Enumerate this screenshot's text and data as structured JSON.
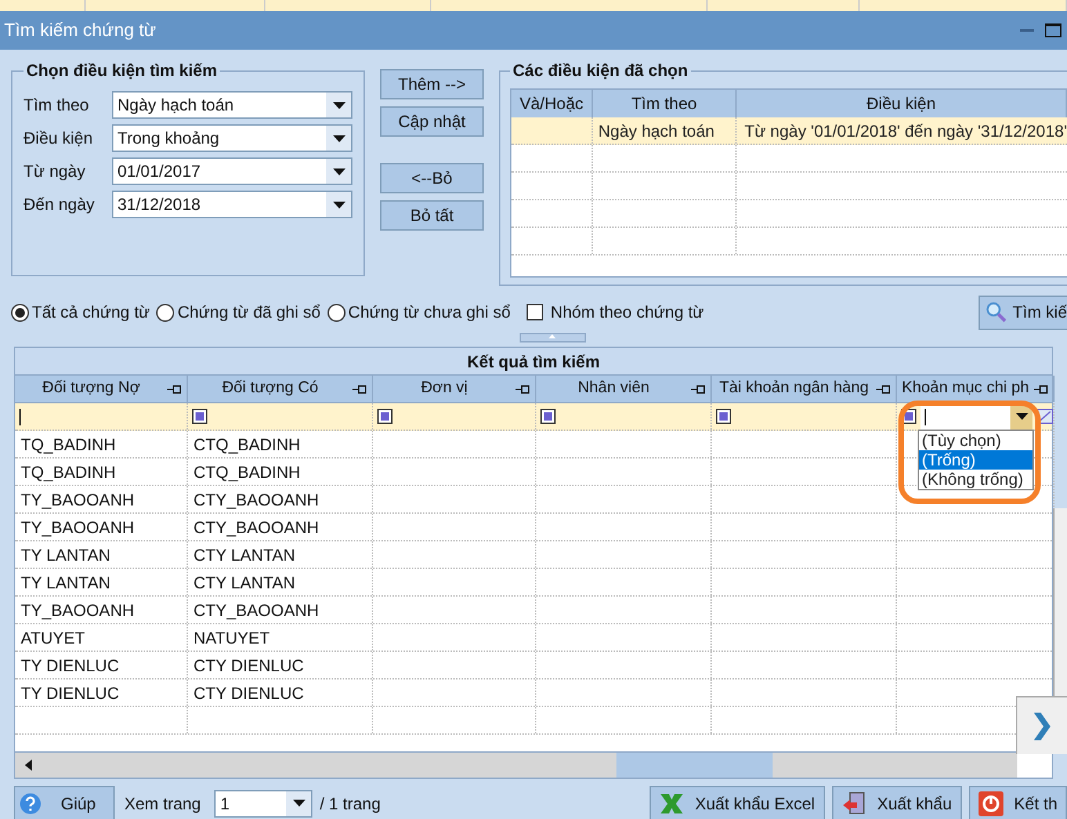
{
  "window": {
    "title": "Tìm kiếm chứng từ"
  },
  "criteria_group": {
    "title": "Chọn điều kiện tìm kiếm",
    "fields": [
      {
        "label": "Tìm theo",
        "value": "Ngày hạch toán"
      },
      {
        "label": "Điều kiện",
        "value": "Trong khoảng"
      },
      {
        "label": "Từ ngày",
        "value": "01/01/2017"
      },
      {
        "label": "Đến ngày",
        "value": "31/12/2018"
      }
    ]
  },
  "middle_buttons": [
    "Thêm -->",
    "Cập nhật",
    "<--Bỏ",
    "Bỏ tất"
  ],
  "selected_group": {
    "title": "Các điều kiện đã chọn",
    "columns": [
      "Và/Hoặc",
      "Tìm theo",
      "Điều kiện"
    ],
    "rows": [
      {
        "search_by": "Ngày hạch toán",
        "condition": "Từ ngày '01/01/2018' đến ngày '31/12/2018'",
        "selected": true
      }
    ]
  },
  "scope_options": [
    {
      "label": "Tất cả chứng từ",
      "selected": true
    },
    {
      "label": "Chứng từ đã ghi sổ",
      "selected": false
    },
    {
      "label": "Chứng từ chưa ghi sổ",
      "selected": false
    }
  ],
  "group_by_voucher": {
    "label": "Nhóm theo chứng từ",
    "checked": false
  },
  "search_button": "Tìm kiế",
  "results": {
    "title": "Kết quả tìm kiếm",
    "columns": [
      "Đối tượng Nợ",
      "Đối tượng Có",
      "Đơn vị",
      "Nhân viên",
      "Tài khoản ngân hàng",
      "Khoản mục chi ph"
    ],
    "rows": [
      [
        "TQ_BADINH",
        "CTQ_BADINH"
      ],
      [
        "TQ_BADINH",
        "CTQ_BADINH"
      ],
      [
        "TY_BAOOANH",
        "CTY_BAOOANH"
      ],
      [
        "TY_BAOOANH",
        "CTY_BAOOANH"
      ],
      [
        "TY LANTAN",
        "CTY LANTAN"
      ],
      [
        "TY LANTAN",
        "CTY LANTAN"
      ],
      [
        "TY_BAOOANH",
        "CTY_BAOOANH"
      ],
      [
        "ATUYET",
        "NATUYET"
      ],
      [
        "TY DIENLUC",
        "CTY DIENLUC"
      ],
      [
        "TY DIENLUC",
        "CTY DIENLUC"
      ]
    ],
    "filter_options": [
      {
        "label": "(Tùy chọn)",
        "selected": false
      },
      {
        "label": "(Trống)",
        "selected": true
      },
      {
        "label": "(Không trống)",
        "selected": false
      }
    ]
  },
  "footer": {
    "help": "Giúp",
    "page_label": "Xem trang",
    "page": "1",
    "page_total": "/ 1 trang",
    "buttons": [
      {
        "label": "Xuất khẩu Excel",
        "kind": "excel"
      },
      {
        "label": "Xuất khẩu",
        "kind": "export"
      },
      {
        "label": "Kết th",
        "kind": "exit"
      }
    ]
  }
}
